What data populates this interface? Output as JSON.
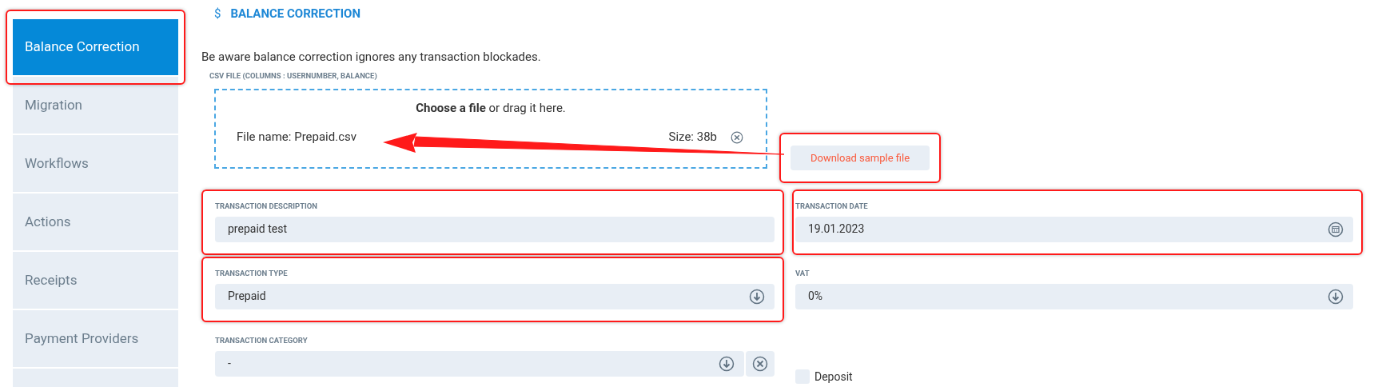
{
  "sidebar": {
    "items": [
      {
        "label": "Balance Correction",
        "selected": true,
        "highlighted": true
      },
      {
        "label": "Migration",
        "selected": false,
        "highlighted": false
      },
      {
        "label": "Workflows",
        "selected": false,
        "highlighted": false
      },
      {
        "label": "Actions",
        "selected": false,
        "highlighted": false
      },
      {
        "label": "Receipts",
        "selected": false,
        "highlighted": false
      },
      {
        "label": "Payment Providers",
        "selected": false,
        "highlighted": false
      },
      {
        "selected": false,
        "highlighted": false
      }
    ]
  },
  "section": {
    "icon": "$",
    "title": "BALANCE CORRECTION"
  },
  "notice": "Be aware balance correction ignores any transaction blockades.",
  "csv_upload": {
    "label": "CSV FILE (COLUMNS : USERNUMBER, BALANCE)",
    "prompt": "**Choose a file** or drag it here.",
    "file_name": "File name: Prepaid.csv",
    "file_size": "Size: 38b"
  },
  "download_button": {
    "label": "Download sample file",
    "highlighted": true
  },
  "annotation_arrow": true,
  "fields": [
    {
      "kind": "text",
      "label": "TRANSACTION DESCRIPTION",
      "value": "prepaid test",
      "highlighted": true
    },
    {
      "kind": "date",
      "label": "TRANSACTION DATE",
      "value": "19.01.2023",
      "highlighted": true
    },
    {
      "kind": "select",
      "label": "TRANSACTION TYPE",
      "value": "Prepaid",
      "highlighted": true
    },
    {
      "kind": "select",
      "label": "VAT",
      "value": "0%",
      "highlighted": false
    },
    {
      "kind": "clearable_select",
      "label": "TRANSACTION CATEGORY",
      "value": "-",
      "highlighted": false
    },
    {
      "kind": "checkbox",
      "label": "Deposit",
      "checked": false,
      "highlighted": false
    }
  ]
}
